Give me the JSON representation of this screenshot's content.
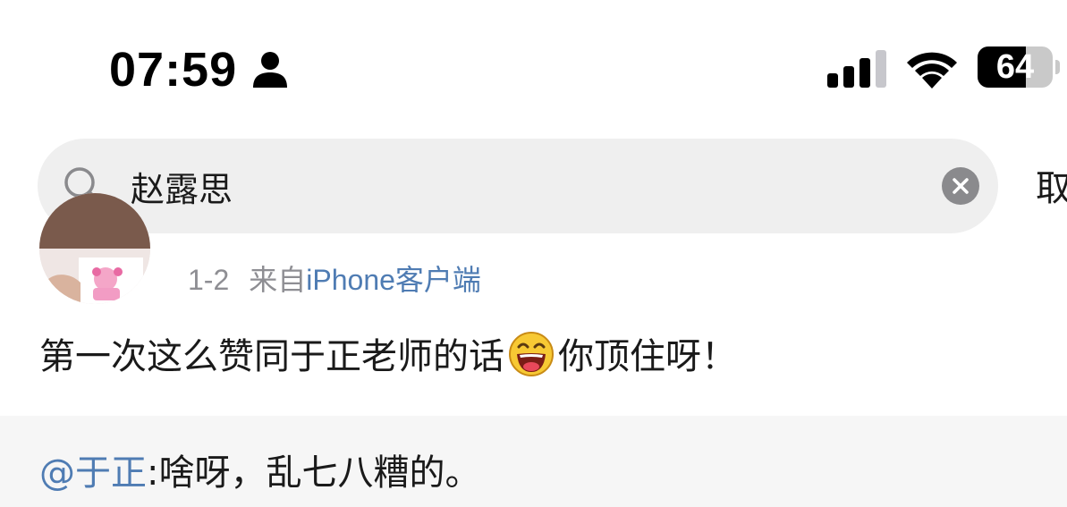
{
  "status_bar": {
    "time": "07:59",
    "battery_level": "64",
    "battery_fraction": 0.64,
    "icons": [
      "person-icon",
      "signal-icon",
      "wifi-icon",
      "battery-icon"
    ]
  },
  "search": {
    "query": "赵露思",
    "cancel_label": "取消"
  },
  "post": {
    "date": "1-2",
    "source_prefix": "来自",
    "source_device": "iPhone客户端",
    "text_before_emoji": "第一次这么赞同于正老师的话",
    "emoji": "laughing-face-icon",
    "text_after_emoji": "你顶住呀！"
  },
  "repost": {
    "mention": "@于正",
    "text": ":啥呀，乱七八糟的。"
  },
  "colors": {
    "link": "#4f7cb3",
    "meta_gray": "#8e8e93",
    "search_bg": "#efefef",
    "repost_bg": "#f6f6f6"
  }
}
